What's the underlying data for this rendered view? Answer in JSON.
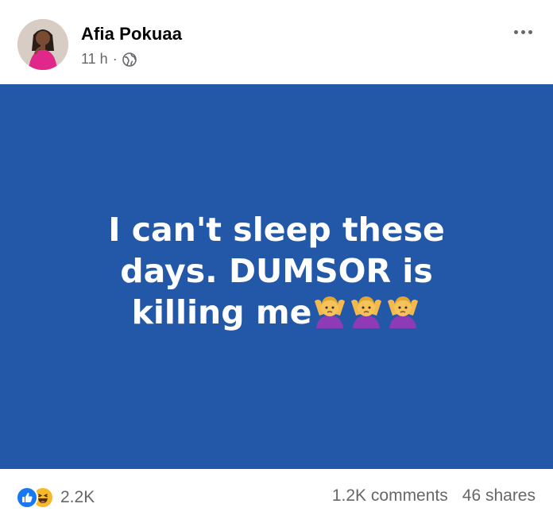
{
  "post": {
    "author_name": "Afia Pokuaa",
    "timestamp": "11 h",
    "separator": "·",
    "privacy_icon": "globe-icon",
    "more_icon": "more-horizontal-icon",
    "text_line1": "I can't sleep these",
    "text_line2": "days.  DUMSOR is",
    "text_line3": "killing me",
    "emoji_name": "person-gesturing-no-emoji",
    "emoji_count": 3,
    "background_color": "#2358a8"
  },
  "footer": {
    "reaction_icons": [
      "like-icon",
      "haha-icon"
    ],
    "reaction_count": "2.2K",
    "comments": "1.2K comments",
    "shares": "46 shares"
  }
}
